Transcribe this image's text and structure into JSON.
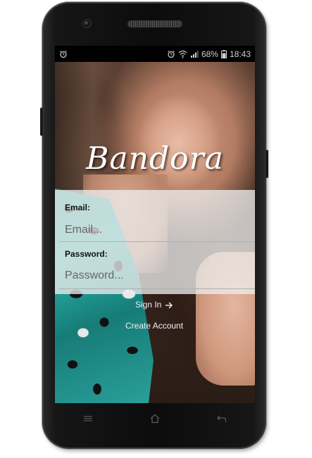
{
  "status_bar": {
    "battery_percent": "68%",
    "time": "18:43",
    "icons": [
      "alarm-icon",
      "alarm-icon",
      "wifi-icon",
      "signal-icon",
      "battery-icon"
    ]
  },
  "brand": {
    "title": "Bandora"
  },
  "login_form": {
    "email_label": "Email:",
    "email_placeholder": "Email...",
    "password_label": "Password:",
    "password_placeholder": "Password..."
  },
  "actions": {
    "sign_in_label": "Sign In",
    "sign_in_icon": "arrow-right-icon",
    "create_account_label": "Create Account"
  },
  "nav_bar": {
    "icons": [
      "menu-icon",
      "home-icon",
      "back-icon"
    ]
  },
  "colors": {
    "form_panel": "#ececec",
    "link_text": "#f0f0f0",
    "brand_text": "#ffffff"
  }
}
